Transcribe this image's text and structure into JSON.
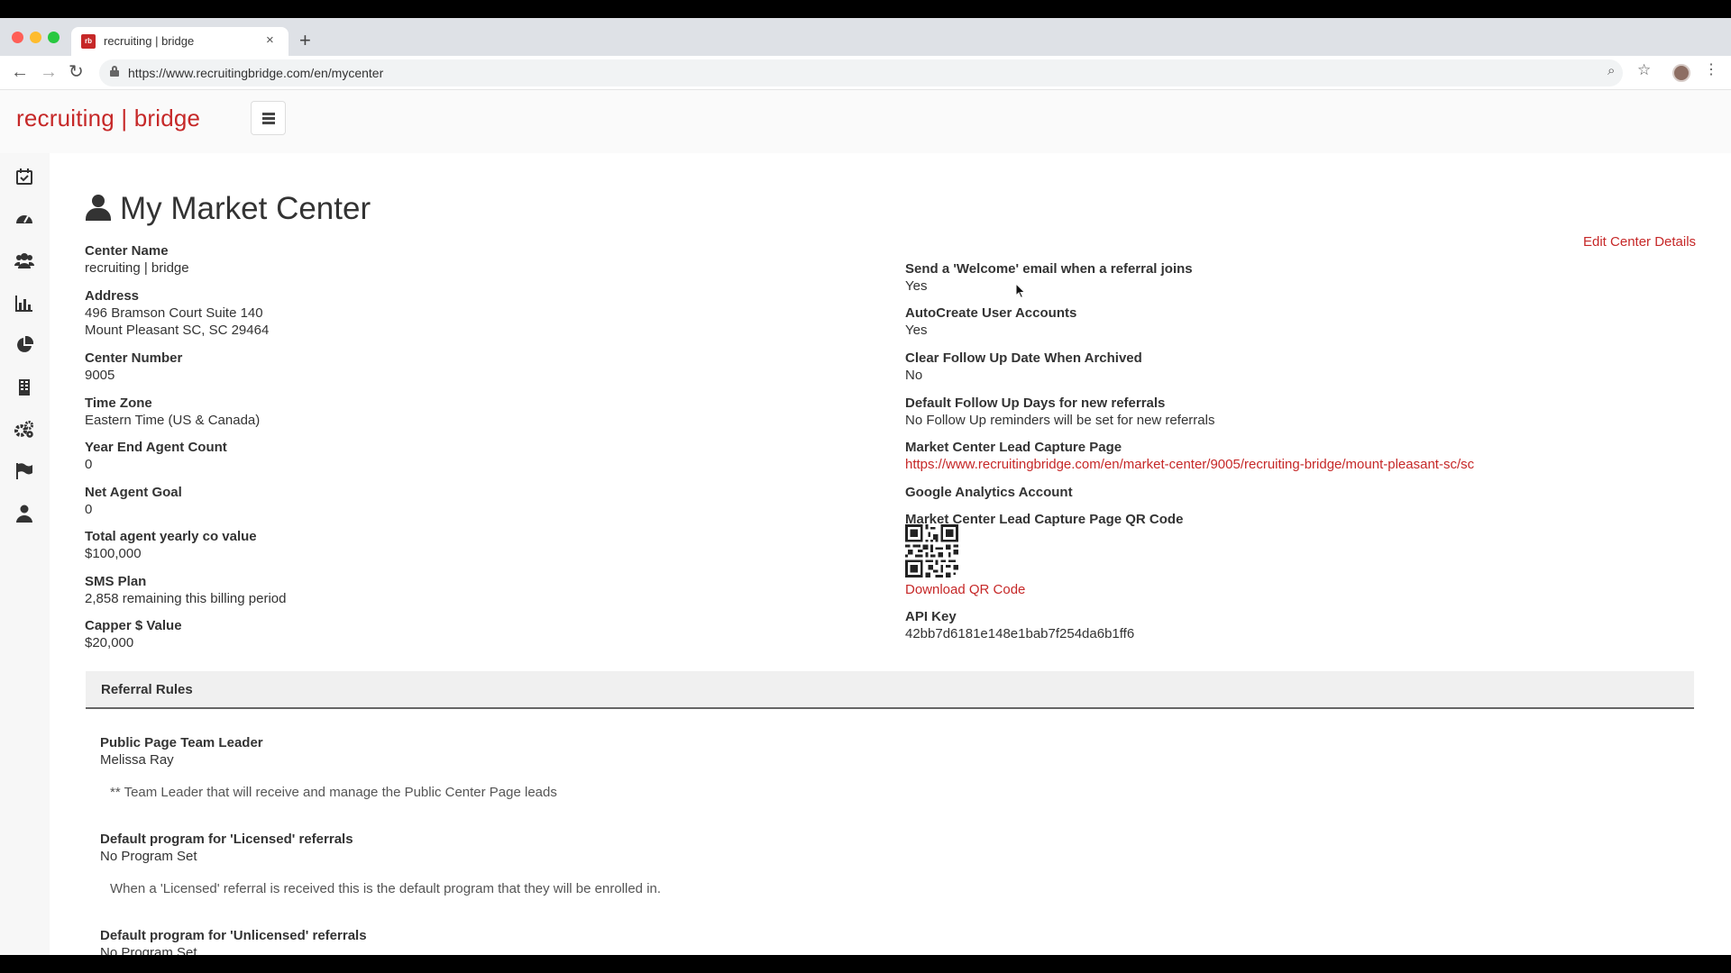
{
  "browser": {
    "tab_title": "recruiting | bridge",
    "favicon_text": "rb",
    "url": "https://www.recruitingbridge.com/en/mycenter",
    "new_tab_symbol": "+",
    "close_symbol": "×"
  },
  "app": {
    "brand": "recruiting | bridge"
  },
  "sidebar": {
    "items": [
      {
        "name": "calendar",
        "icon": "calendar-check-icon"
      },
      {
        "name": "dashboard",
        "icon": "dashboard-gauge-icon"
      },
      {
        "name": "users",
        "icon": "users-group-icon"
      },
      {
        "name": "reports",
        "icon": "bar-chart-icon"
      },
      {
        "name": "analytics",
        "icon": "pie-chart-icon"
      },
      {
        "name": "building",
        "icon": "building-icon"
      },
      {
        "name": "settings",
        "icon": "gears-icon"
      },
      {
        "name": "flag",
        "icon": "flag-icon"
      },
      {
        "name": "profile",
        "icon": "user-icon"
      }
    ]
  },
  "page": {
    "title": "My Market Center",
    "edit_link": "Edit Center Details"
  },
  "left_fields": [
    {
      "label": "Center Name",
      "value": "recruiting | bridge"
    },
    {
      "label": "Address",
      "value": "496 Bramson Court Suite 140",
      "value2": "Mount Pleasant SC, SC 29464"
    },
    {
      "label": "Center Number",
      "value": "9005"
    },
    {
      "label": "Time Zone",
      "value": "Eastern Time (US & Canada)"
    },
    {
      "label": "Year End Agent Count",
      "value": "0"
    },
    {
      "label": "Net Agent Goal",
      "value": "0"
    },
    {
      "label": "Total agent yearly co value",
      "value": "$100,000"
    },
    {
      "label": "SMS Plan",
      "value": "2,858 remaining this billing period"
    },
    {
      "label": "Capper $ Value",
      "value": "$20,000"
    }
  ],
  "right_fields": {
    "welcome_email": {
      "label": "Send a 'Welcome' email when a referral joins",
      "value": "Yes"
    },
    "autocreate": {
      "label": "AutoCreate User Accounts",
      "value": "Yes"
    },
    "clear_followup": {
      "label": "Clear Follow Up Date When Archived",
      "value": "No"
    },
    "default_followup": {
      "label": "Default Follow Up Days for new referrals",
      "value": "No Follow Up reminders will be set for new referrals"
    },
    "lead_capture": {
      "label": "Market Center Lead Capture Page",
      "value": "https://www.recruitingbridge.com/en/market-center/9005/recruiting-bridge/mount-pleasant-sc/sc"
    },
    "google_analytics": {
      "label": "Google Analytics Account"
    },
    "qr_code": {
      "label": "Market Center Lead Capture Page QR Code",
      "link": "Download QR Code"
    },
    "api_key": {
      "label": "API Key",
      "value": "42bb7d6181e148e1bab7f254da6b1ff6"
    }
  },
  "referral_rules": {
    "title": "Referral Rules",
    "team_leader": {
      "label": "Public Page Team Leader",
      "value": "Melissa Ray",
      "note": "** Team Leader that will receive and manage the Public Center Page leads"
    },
    "licensed": {
      "label": "Default program for 'Licensed' referrals",
      "value": "No Program Set",
      "note": "When a 'Licensed' referral is received this is the default program that they will be enrolled in."
    },
    "unlicensed": {
      "label": "Default program for 'Unlicensed' referrals",
      "value": "No Program Set"
    }
  },
  "colors": {
    "accent": "#c62828",
    "text": "#333333",
    "page_bg": "#f7f7f7"
  }
}
